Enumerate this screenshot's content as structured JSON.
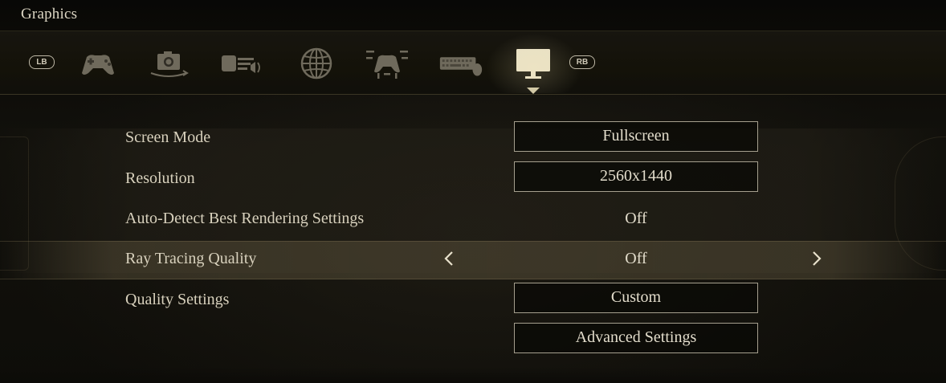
{
  "window": {
    "title": "Graphics"
  },
  "tabs": {
    "left_bumper": "LB",
    "right_bumper": "RB",
    "items": [
      {
        "icon": "gamepad-icon"
      },
      {
        "icon": "camera-rotate-icon"
      },
      {
        "icon": "audio-speaker-icon"
      },
      {
        "icon": "globe-icon"
      },
      {
        "icon": "controller-mapping-icon"
      },
      {
        "icon": "keyboard-mouse-icon"
      },
      {
        "icon": "monitor-icon",
        "active": true
      }
    ]
  },
  "settings": {
    "screen_mode": {
      "label": "Screen Mode",
      "value": "Fullscreen"
    },
    "resolution": {
      "label": "Resolution",
      "value": "2560x1440"
    },
    "auto_detect": {
      "label": "Auto-Detect Best Rendering Settings",
      "value": "Off"
    },
    "ray_tracing": {
      "label": "Ray Tracing Quality",
      "value": "Off"
    },
    "quality": {
      "label": "Quality Settings",
      "value": "Custom"
    },
    "advanced": {
      "label": "Advanced Settings"
    }
  },
  "colors": {
    "accent": "#cfc6a4",
    "text": "#d8d1bd",
    "box_border": "#a59f8e"
  }
}
